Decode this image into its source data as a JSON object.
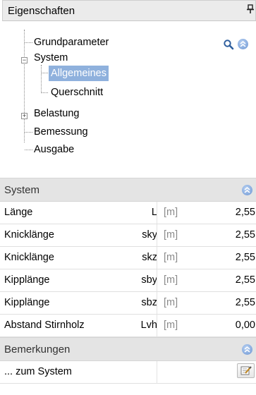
{
  "panel": {
    "title": "Eigenschaften",
    "pin_glyph": "ᵖ"
  },
  "tree": {
    "items": [
      {
        "label": "Grundparameter"
      },
      {
        "label": "System"
      },
      {
        "label": "Allgemeines"
      },
      {
        "label": "Querschnitt"
      },
      {
        "label": "Belastung"
      },
      {
        "label": "Bemessung"
      },
      {
        "label": "Ausgabe"
      }
    ],
    "selected": "Allgemeines"
  },
  "system": {
    "title": "System",
    "rows": [
      {
        "name": "Länge",
        "symbol": "L",
        "unit": "[m]",
        "value": "2,55"
      },
      {
        "name": "Knicklänge",
        "symbol": "sky",
        "unit": "[m]",
        "value": "2,55"
      },
      {
        "name": "Knicklänge",
        "symbol": "skz",
        "unit": "[m]",
        "value": "2,55"
      },
      {
        "name": "Kipplänge",
        "symbol": "sby",
        "unit": "[m]",
        "value": "2,55"
      },
      {
        "name": "Kipplänge",
        "symbol": "sbz",
        "unit": "[m]",
        "value": "2,55"
      },
      {
        "name": "Abstand Stirnholz",
        "symbol": "Lvh",
        "unit": "[m]",
        "value": "0,00"
      }
    ]
  },
  "bemerkungen": {
    "title": "Bemerkungen",
    "rows": [
      {
        "name": "... zum System"
      }
    ]
  },
  "icons": {
    "pin": "pin-icon",
    "search": "search-icon",
    "collapse": "collapse-up-icon",
    "edit": "edit-icon"
  },
  "colors": {
    "selection": "#8fb1dd",
    "accent": "#6d96d3",
    "header_bg": "#e4e4e4"
  }
}
